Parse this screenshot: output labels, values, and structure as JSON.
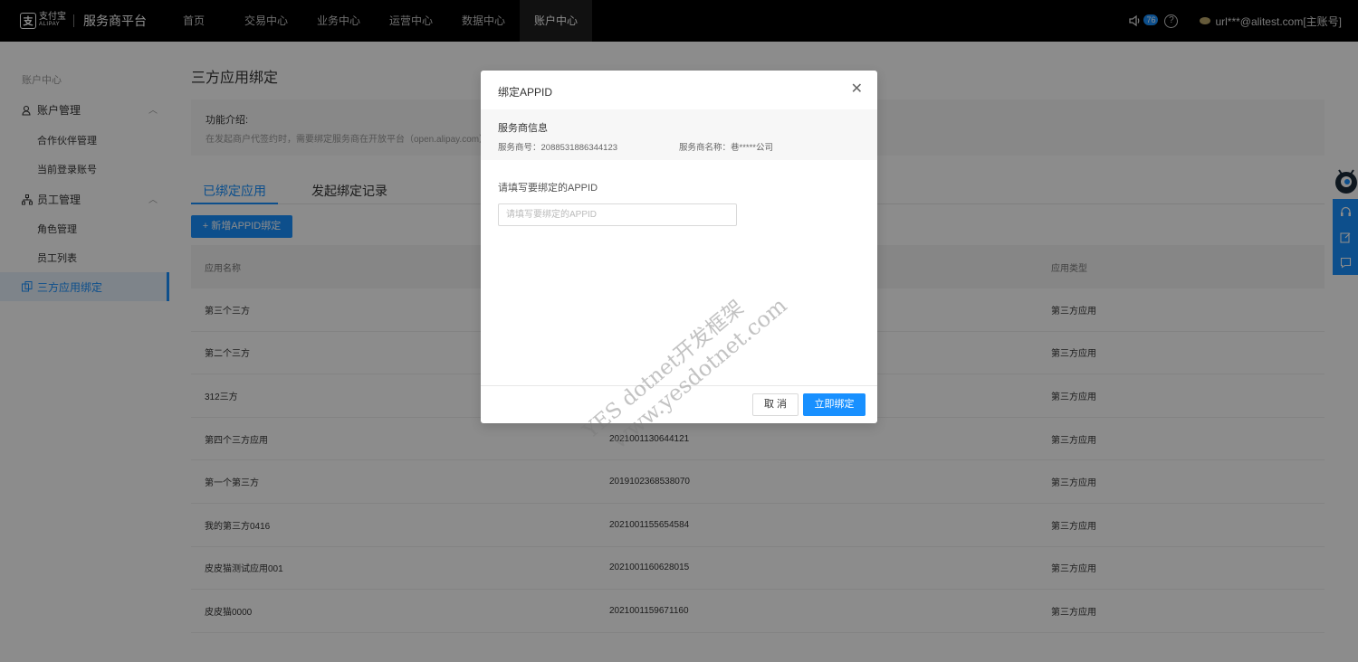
{
  "header": {
    "logo_mark": "支",
    "logo_cn": "支付宝",
    "logo_en": "ALIPAY",
    "platform_name": "服务商平台",
    "nav": [
      {
        "label": "首页",
        "active": false
      },
      {
        "label": "交易中心",
        "active": false
      },
      {
        "label": "业务中心",
        "active": false
      },
      {
        "label": "运营中心",
        "active": false
      },
      {
        "label": "数据中心",
        "active": false
      },
      {
        "label": "账户中心",
        "active": true
      }
    ],
    "notification_count": "76",
    "help_glyph": "?",
    "user": "url***@alitest.com[主账号]"
  },
  "sidebar": {
    "title": "账户中心",
    "groups": [
      {
        "label": "账户管理",
        "chevron": "︿",
        "items": [
          "合作伙伴管理",
          "当前登录账号"
        ]
      },
      {
        "label": "员工管理",
        "chevron": "︿",
        "items": [
          "角色管理",
          "员工列表"
        ]
      }
    ],
    "active_item": "三方应用绑定"
  },
  "main": {
    "title": "三方应用绑定",
    "intro_title": "功能介绍:",
    "intro_desc": "在发起商户代签约时，需要绑定服务商在开放平台（open.alipay.com）创",
    "tabs": [
      {
        "label": "已绑定应用",
        "active": true
      },
      {
        "label": "发起绑定记录",
        "active": false
      }
    ],
    "add_button": "+ 新增APPID绑定",
    "table": {
      "columns": [
        "应用名称",
        "",
        "应用类型"
      ],
      "rows": [
        {
          "name": "第三个三方",
          "appid": "",
          "type": "第三方应用"
        },
        {
          "name": "第二个三方",
          "appid": "",
          "type": "第三方应用"
        },
        {
          "name": "312三方",
          "appid": "",
          "type": "第三方应用"
        },
        {
          "name": "第四个三方应用",
          "appid": "2021001130644121",
          "type": "第三方应用"
        },
        {
          "name": "第一个第三方",
          "appid": "2019102368538070",
          "type": "第三方应用"
        },
        {
          "name": "我的第三方0416",
          "appid": "2021001155654584",
          "type": "第三方应用"
        },
        {
          "name": "皮皮猫测试应用001",
          "appid": "2021001160628015",
          "type": "第三方应用"
        },
        {
          "name": "皮皮猫0000",
          "appid": "2021001159671160",
          "type": "第三方应用"
        }
      ]
    }
  },
  "modal": {
    "title": "绑定APPID",
    "close_glyph": "✕",
    "info_heading": "服务商信息",
    "provider_id": "服务商号：2088531886344123",
    "provider_name": "服务商名称：巷*****公司",
    "field_label": "请填写要绑定的APPID",
    "field_placeholder": "请填写要绑定的APPID",
    "field_value": "",
    "cancel_label": "取 消",
    "confirm_label": "立即绑定"
  },
  "watermark": {
    "line1": "YES dotnet开发框架",
    "line2": "www.yesdotnet.com"
  },
  "colors": {
    "topbar": "#000000",
    "primary": "#1890ff",
    "overlay": "rgba(0,0,0,0.45)"
  },
  "icons": [
    "volume-icon",
    "help-icon",
    "user-avatar-icon",
    "account-icon",
    "staff-icon",
    "bind-icon",
    "close-icon",
    "robot-icon",
    "headset-icon",
    "edit-icon",
    "feedback-icon"
  ]
}
